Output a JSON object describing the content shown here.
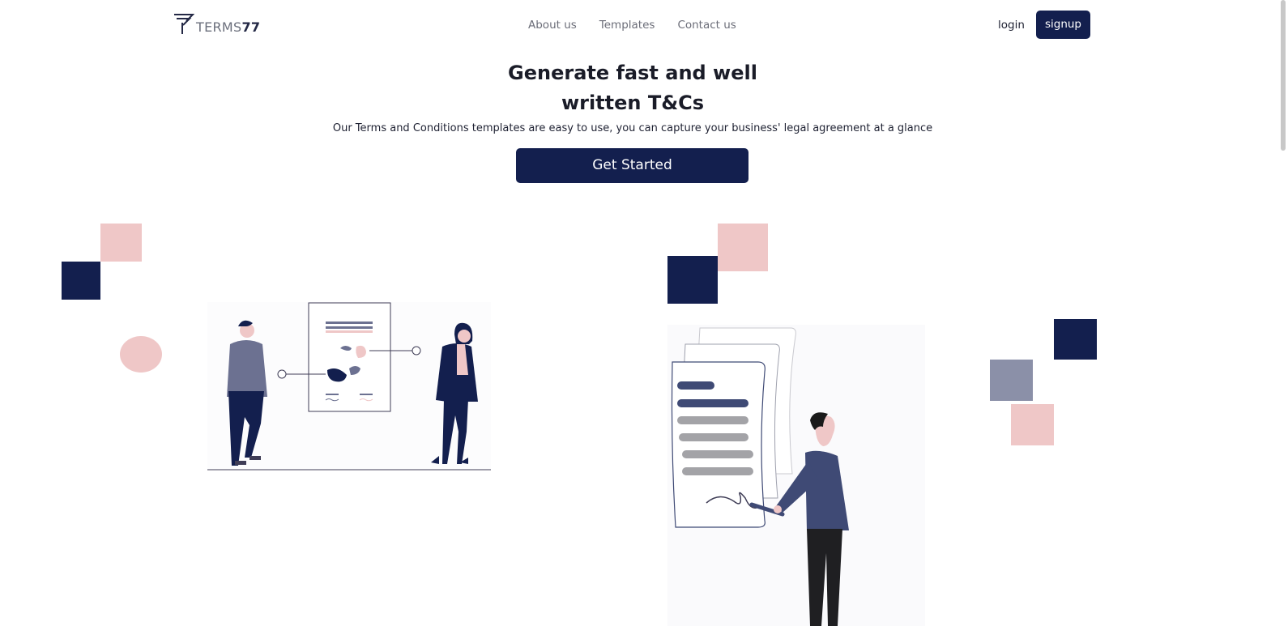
{
  "brand": {
    "name_prefix": "TERMS",
    "name_suffix": "77",
    "logo_icon": "terms77-logo-icon"
  },
  "nav": {
    "items": [
      "About us",
      "Templates",
      "Contact us"
    ]
  },
  "auth": {
    "login_label": "login",
    "signup_label": "signup"
  },
  "hero": {
    "title_line1": "Generate fast and well",
    "title_line2": "written T&Cs",
    "subtitle": "Our Terms and Conditions templates are easy to use, you can capture your business' legal agreement at a glance",
    "cta_label": "Get Started"
  },
  "colors": {
    "navy": "#131f4e",
    "pink": "#efc7c7",
    "slate": "#8b90a8"
  }
}
